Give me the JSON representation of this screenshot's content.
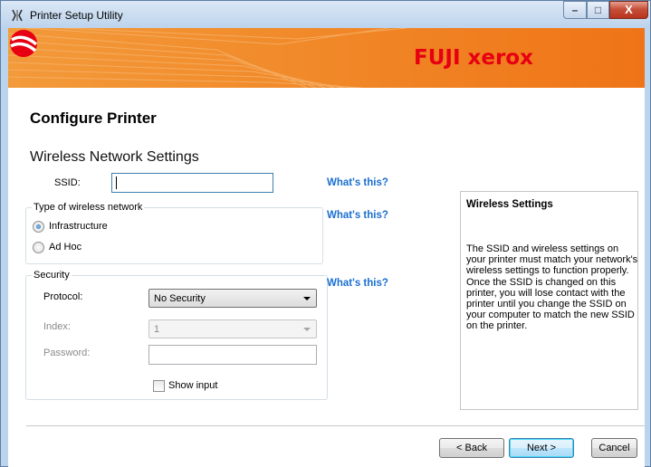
{
  "window": {
    "title": "Printer Setup Utility",
    "minimize_glyph": "–",
    "maximize_glyph": "□",
    "close_glyph": "X"
  },
  "banner": {
    "brand_text": "FUJI xerox",
    "logo_icon": "xerox-sphere-logo",
    "colors": {
      "orange": "#f18a2a",
      "brand_red": "#e60012"
    }
  },
  "page": {
    "heading": "Configure Printer",
    "section_title": "Wireless Network Settings"
  },
  "ssid": {
    "label": "SSID:",
    "value": "",
    "help_link": "What's this?"
  },
  "network_type": {
    "legend": "Type of wireless network",
    "help_link": "What's this?",
    "options": [
      {
        "label": "Infrastructure",
        "selected": true
      },
      {
        "label": "Ad Hoc",
        "selected": false
      }
    ]
  },
  "security": {
    "legend": "Security",
    "help_link": "What's this?",
    "protocol_label": "Protocol:",
    "protocol_value": "No Security",
    "index_label": "Index:",
    "index_value": "1",
    "password_label": "Password:",
    "password_value": "",
    "show_input_label": "Show input",
    "show_input_checked": false
  },
  "info_panel": {
    "title": "Wireless Settings",
    "body": "The SSID and wireless settings on your printer must match your network's wireless settings to function properly. Once the SSID is changed on this printer, you will lose contact with the printer until you change the SSID on your computer to match the new SSID on the printer."
  },
  "buttons": {
    "back": "< Back",
    "next": "Next >",
    "cancel": "Cancel"
  }
}
